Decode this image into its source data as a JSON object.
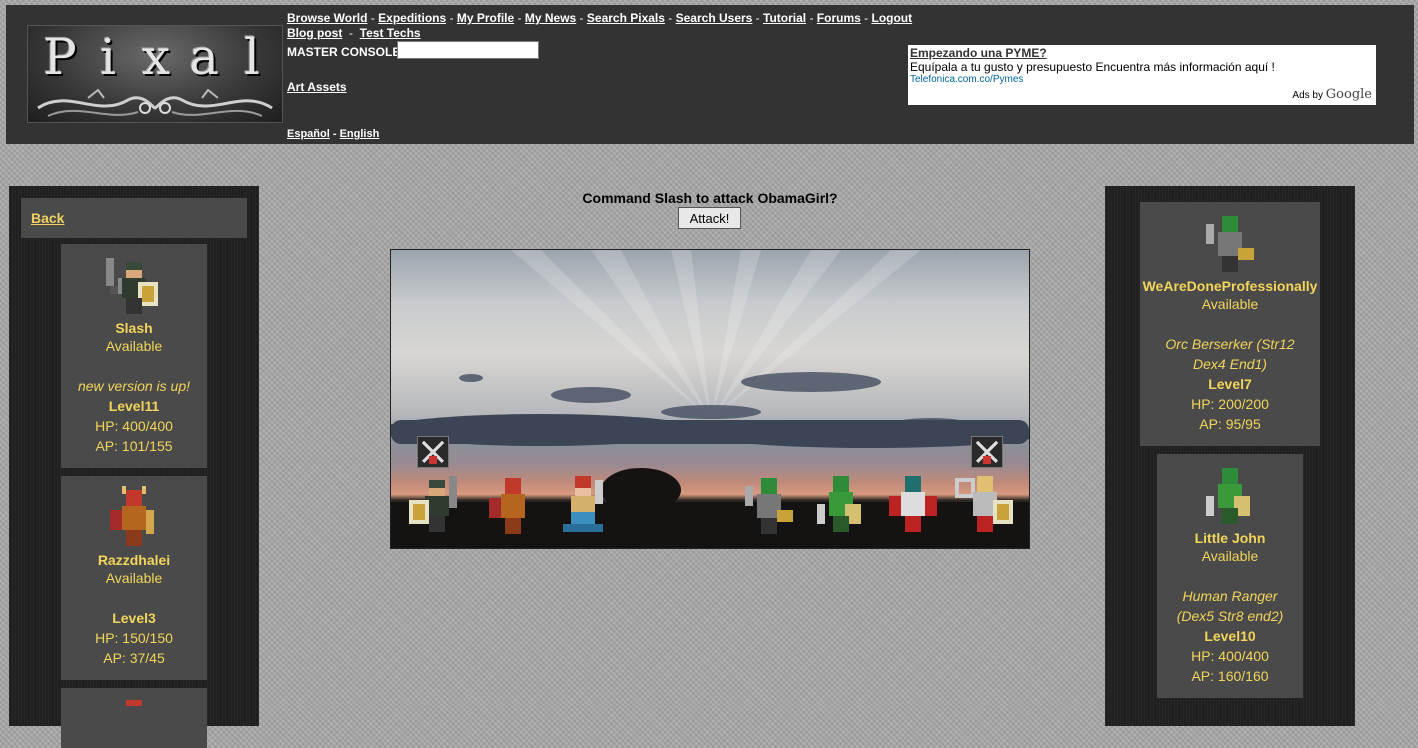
{
  "header": {
    "logo_text": "Pixal",
    "nav_row1": [
      "Browse World",
      "Expeditions",
      "My Profile",
      "My News",
      "Search Pixals",
      "Search Users",
      "Tutorial",
      "Forums",
      "Logout"
    ],
    "nav_row2": [
      "Blog post",
      "Test Techs"
    ],
    "console_label": "MASTER CONSOLE:",
    "console_value": "",
    "art_assets": "Art Assets",
    "lang_es": "Español",
    "lang_en": "English",
    "lang_sep": "-"
  },
  "ad": {
    "title": "Empezando una PYME?",
    "body": "Equípala a tu gusto y presupuesto Encuentra más información aquí !",
    "url": "Telefonica.com.co/Pymes",
    "ads_by": "Ads by",
    "brand": "Google"
  },
  "left": {
    "back": "Back",
    "cards": [
      {
        "name": "Slash",
        "status": "Available",
        "note": "new version is up!",
        "level": "Level11",
        "hp": "HP: 400/400",
        "ap": "AP: 101/155"
      },
      {
        "name": "Razzdhalei",
        "status": "Available",
        "note": "",
        "level": "Level3",
        "hp": "HP: 150/150",
        "ap": "AP: 37/45"
      }
    ]
  },
  "center": {
    "command": "Command Slash to attack ObamaGirl?",
    "attack_label": "Attack!"
  },
  "right": {
    "cards": [
      {
        "name": "WeAreDoneProfessionally",
        "status": "Available",
        "note": "Orc Berserker (Str12 Dex4 End1)",
        "level": "Level7",
        "hp": "HP: 200/200",
        "ap": "AP: 95/95"
      },
      {
        "name": "Little John",
        "status": "Available",
        "note": "Human Ranger (Dex5 Str8 end2)",
        "level": "Level10",
        "hp": "HP: 400/400",
        "ap": "AP: 160/160"
      }
    ]
  },
  "colors": {
    "accent": "#f2d55a",
    "header_bg": "#333333",
    "panel_bg": "#202020",
    "card_bg": "#4a4a4a"
  }
}
